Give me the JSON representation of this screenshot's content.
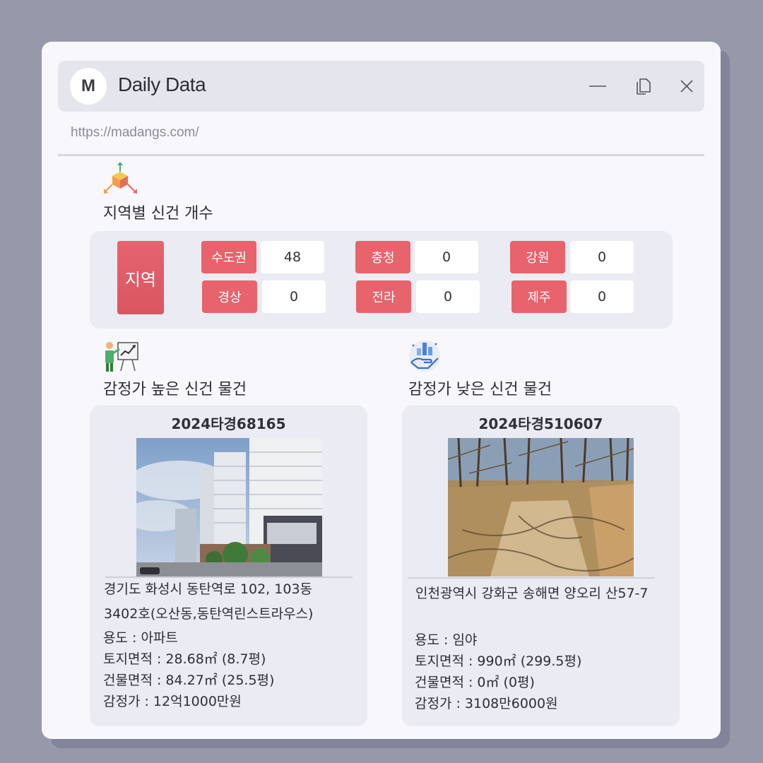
{
  "window": {
    "logo_letter": "M",
    "title": "Daily Data",
    "url": "https://madangs.com/"
  },
  "region_section": {
    "title": "지역별 신건 개수",
    "main_label": "지역",
    "regions": [
      {
        "name": "수도권",
        "count": "48"
      },
      {
        "name": "충청",
        "count": "0"
      },
      {
        "name": "강원",
        "count": "0"
      },
      {
        "name": "경상",
        "count": "0"
      },
      {
        "name": "전라",
        "count": "0"
      },
      {
        "name": "제주",
        "count": "0"
      }
    ]
  },
  "high_section": {
    "title": "감정가 높은 신건 물건",
    "case_no": "2024타경68165",
    "address_line1": "경기도 화성시 동탄역로 102, 103동",
    "address_line2": "3402호(오산동,동탄역린스트라우스)",
    "usage": "용도 : 아파트",
    "land_area": "토지면적 : 28.68㎡ (8.7평)",
    "building_area": "건물면적 : 84.27㎡ (25.5평)",
    "appraisal": "감정가 : 12억1000만원"
  },
  "low_section": {
    "title": "감정가 낮은 신건 물건",
    "case_no": "2024타경510607",
    "address_line1": "인천광역시 강화군 송해면 양오리 산57-7",
    "usage": "용도 : 임야",
    "land_area": "토지면적 : 990㎡ (299.5평)",
    "building_area": "건물면적 :  0㎡ (0평)",
    "appraisal": "감정가 : 3108만6000원"
  },
  "icons": {
    "region": "3d-axis-cube-icon",
    "high": "presentation-chart-icon",
    "low": "hand-chart-icon",
    "window_controls": [
      "minimize-icon",
      "copy-icon",
      "close-icon"
    ]
  },
  "colors": {
    "accent_red": "#e8636c",
    "background": "#9799aa",
    "window": "#f7f7fc"
  }
}
